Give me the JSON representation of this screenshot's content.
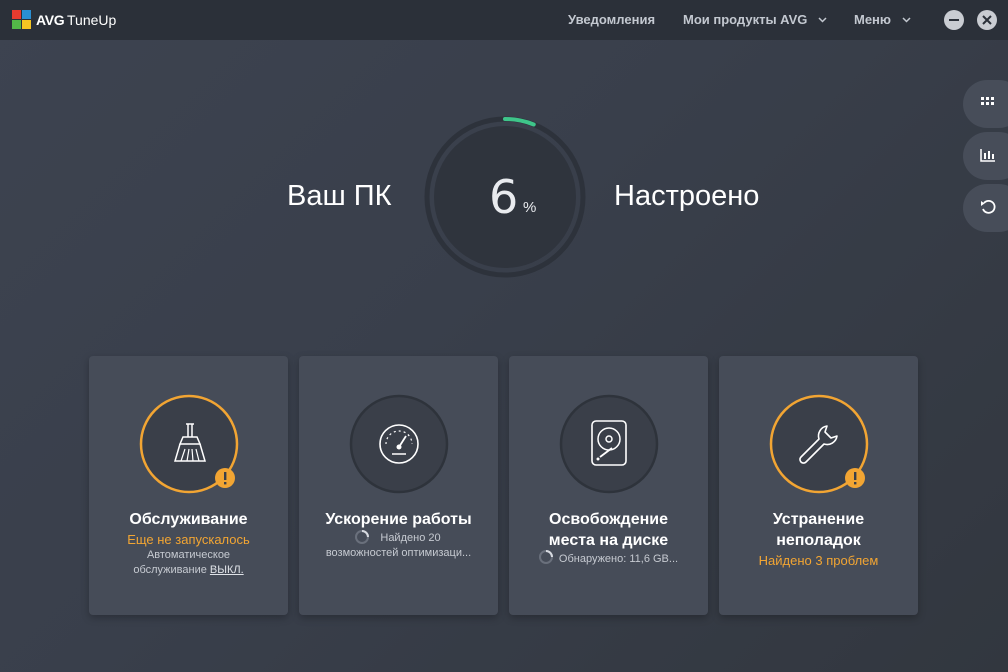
{
  "app": {
    "brand_bold": "AVG",
    "brand_name": "TuneUp"
  },
  "nav": {
    "notifications": "Уведомления",
    "products": "Мои продукты AVG",
    "menu": "Меню"
  },
  "status": {
    "left_text": "Ваш ПК",
    "right_text": "Настроено",
    "percent_value": "6",
    "percent_sign": "%",
    "progress_fraction": 0.06
  },
  "side_panel": {
    "icons": [
      "grid-icon",
      "chart-icon",
      "undo-icon"
    ]
  },
  "cards": [
    {
      "title_line1": "Обслуживание",
      "status": "Еще не запускалось",
      "detail_line1": "Автоматическое",
      "detail_prefix": "обслуживание",
      "detail_link": "ВЫКЛ.",
      "icon": "broom-icon",
      "warning": true
    },
    {
      "title_line1": "Ускорение работы",
      "detail_line1": "Найдено 20",
      "detail_line2": "возможностей оптимизаци...",
      "icon": "speedometer-icon",
      "warning": false
    },
    {
      "title_line1": "Освобождение",
      "title_line2": "места на диске",
      "detail_line1": "Обнаружено: 11,6 GB...",
      "icon": "hard-drive-icon",
      "warning": false
    },
    {
      "title_line1": "Устранение",
      "title_line2": "неполадок",
      "status": "Найдено 3 проблем",
      "icon": "wrench-icon",
      "warning": true
    }
  ],
  "colors": {
    "accent_orange": "#f2a533",
    "progress_green": "#3ec58a",
    "background": "#3b414c",
    "card": "#464c58"
  }
}
